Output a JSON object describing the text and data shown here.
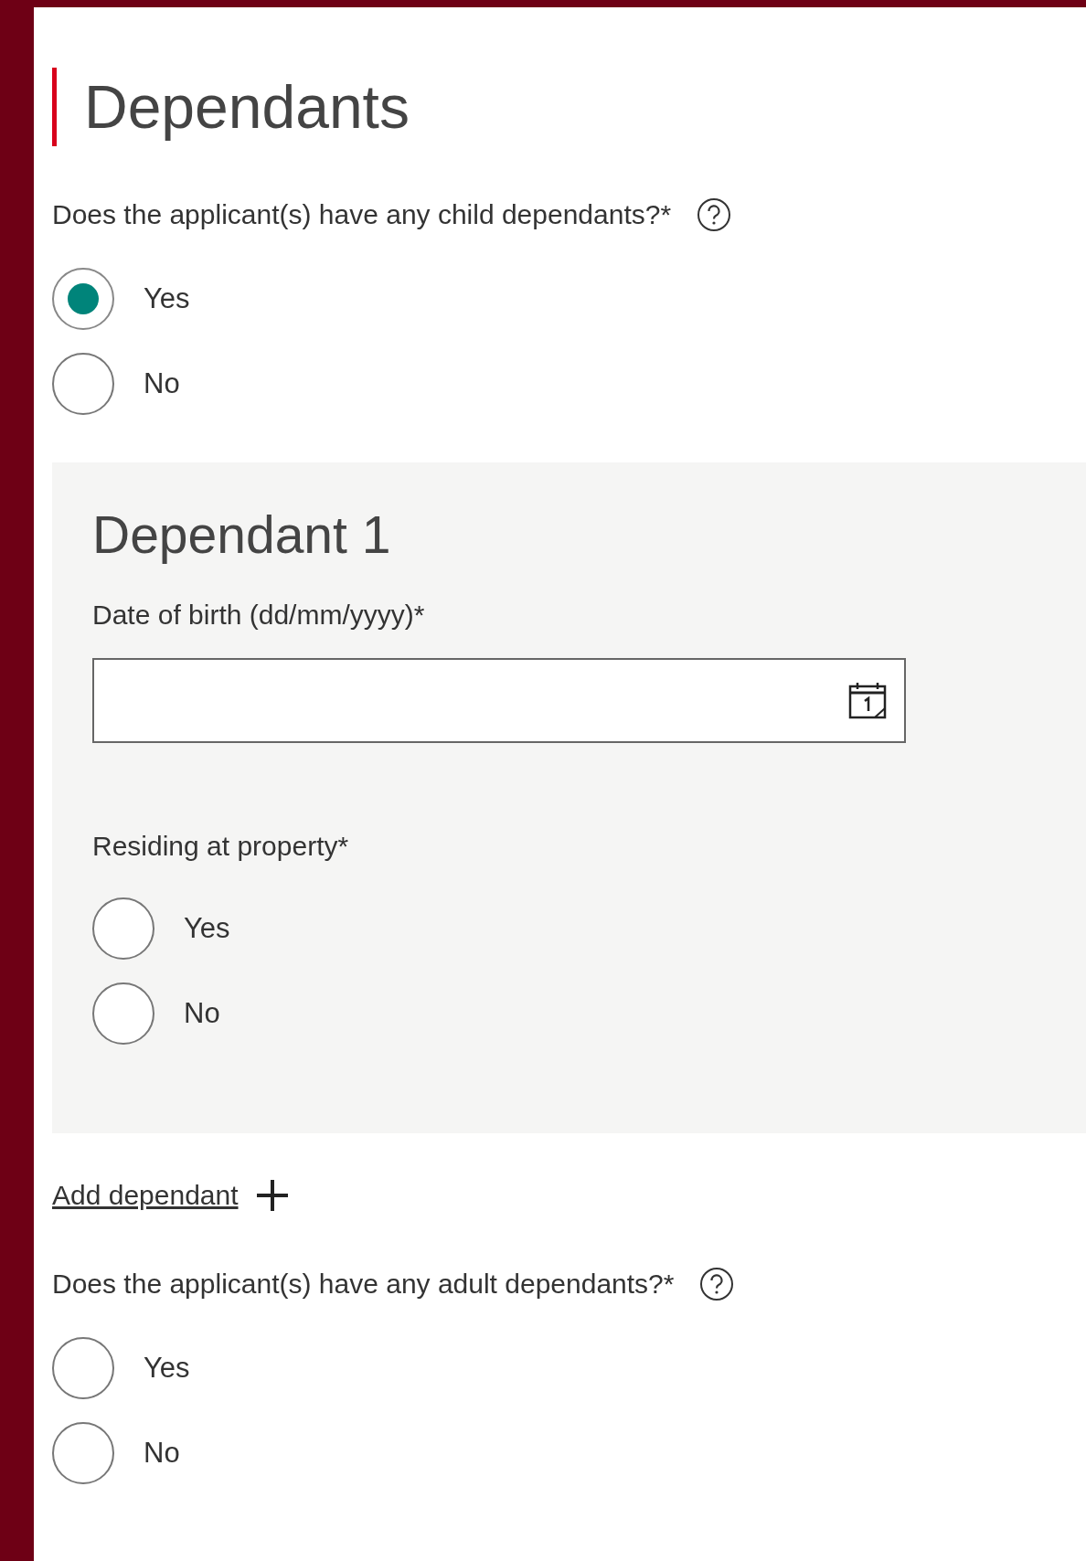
{
  "page": {
    "title": "Dependants"
  },
  "child_dependants": {
    "label": "Does the applicant(s) have any child dependants?*",
    "options": [
      {
        "label": "Yes",
        "selected": true
      },
      {
        "label": "No",
        "selected": false
      }
    ]
  },
  "dependants": [
    {
      "title": "Dependant 1",
      "date_of_birth": {
        "label": "Date of birth (dd/mm/yyyy)*"
      },
      "residing": {
        "label": "Residing at property*",
        "options": [
          {
            "label": "Yes",
            "selected": false
          },
          {
            "label": "No",
            "selected": false
          }
        ]
      }
    }
  ],
  "add_dependant": {
    "label": "Add dependant"
  },
  "adult_dependants": {
    "label": "Does the applicant(s) have any adult dependants?*",
    "options": [
      {
        "label": "Yes",
        "selected": false
      },
      {
        "label": "No",
        "selected": false
      }
    ]
  }
}
